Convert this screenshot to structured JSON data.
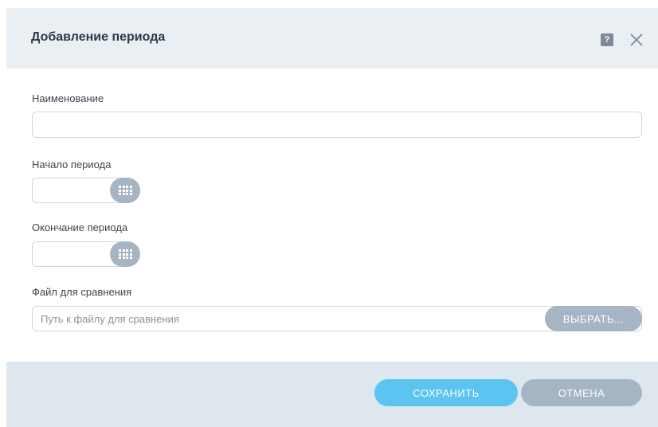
{
  "dialog": {
    "title": "Добавление периода",
    "help_icon": "help-icon",
    "help_glyph": "?",
    "close_icon": "close-icon"
  },
  "form": {
    "name": {
      "label": "Наименование",
      "value": ""
    },
    "period_start": {
      "label": "Начало периода",
      "value": "",
      "picker_icon": "calendar-grid-icon"
    },
    "period_end": {
      "label": "Окончание периода",
      "value": "",
      "picker_icon": "calendar-grid-icon"
    },
    "compare_file": {
      "label": "Файл для сравнения",
      "value": "",
      "placeholder": "Путь к файлу для сравнения",
      "choose_label": "ВЫБРАТЬ..."
    }
  },
  "footer": {
    "save_label": "СОХРАНИТЬ",
    "cancel_label": "ОТМЕНА"
  },
  "colors": {
    "header_bg": "#eaeff4",
    "footer_bg": "#dfe7ee",
    "primary_button": "#5bc4f1",
    "secondary_button": "#a6b5c4"
  }
}
